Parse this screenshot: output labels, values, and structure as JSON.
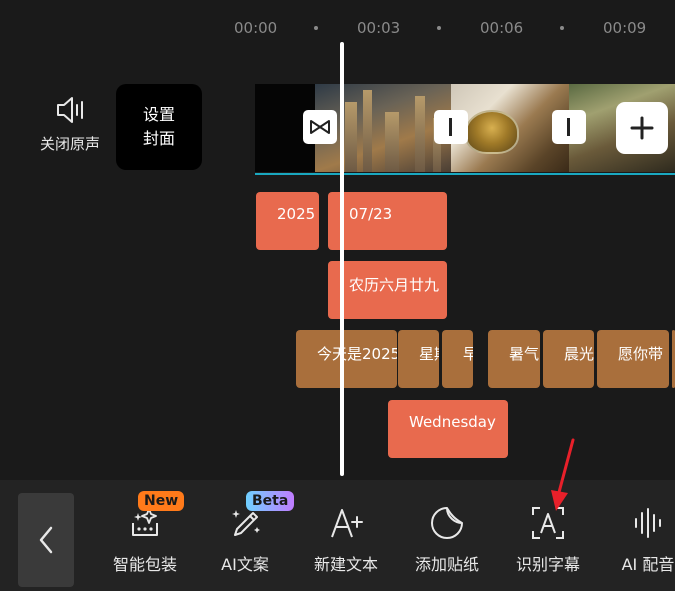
{
  "ruler": {
    "ticks": [
      "00:00",
      "00:03",
      "00:06",
      "00:09"
    ]
  },
  "left_panel": {
    "mute_label": "关闭原声",
    "cover_line1": "设置",
    "cover_line2": "封面"
  },
  "tracks": {
    "text_blocks": [
      {
        "text": "2025",
        "color": "#e86a4e"
      },
      {
        "text": "07/23",
        "color": "#e86a4e"
      },
      {
        "text": "农历六月廿九",
        "color": "#e86a4e"
      },
      {
        "text": "今天是2025",
        "color": "#a96f3c"
      },
      {
        "text": "星期",
        "color": "#a96f3c"
      },
      {
        "text": "早",
        "color": "#a96f3c"
      },
      {
        "text": "暑气",
        "color": "#a96f3c"
      },
      {
        "text": "晨光",
        "color": "#a96f3c"
      },
      {
        "text": "愿你带",
        "color": "#a96f3c"
      },
      {
        "text": "Wednesday",
        "color": "#e86a4e"
      }
    ]
  },
  "toolbar": {
    "items": [
      {
        "label": "智能包装",
        "icon": "magic-package-icon",
        "badge": "New"
      },
      {
        "label": "AI文案",
        "icon": "ai-pen-icon",
        "badge": "Beta"
      },
      {
        "label": "新建文本",
        "icon": "add-text-icon"
      },
      {
        "label": "添加贴纸",
        "icon": "sticker-icon"
      },
      {
        "label": "识别字幕",
        "icon": "recognize-caption-icon"
      },
      {
        "label": "AI 配音",
        "icon": "ai-voice-icon"
      }
    ]
  },
  "colors": {
    "accent_red": "#e86a4e",
    "accent_brown": "#a96f3c",
    "track_line": "#1aa8c0",
    "annotation_arrow": "#e8202a"
  }
}
